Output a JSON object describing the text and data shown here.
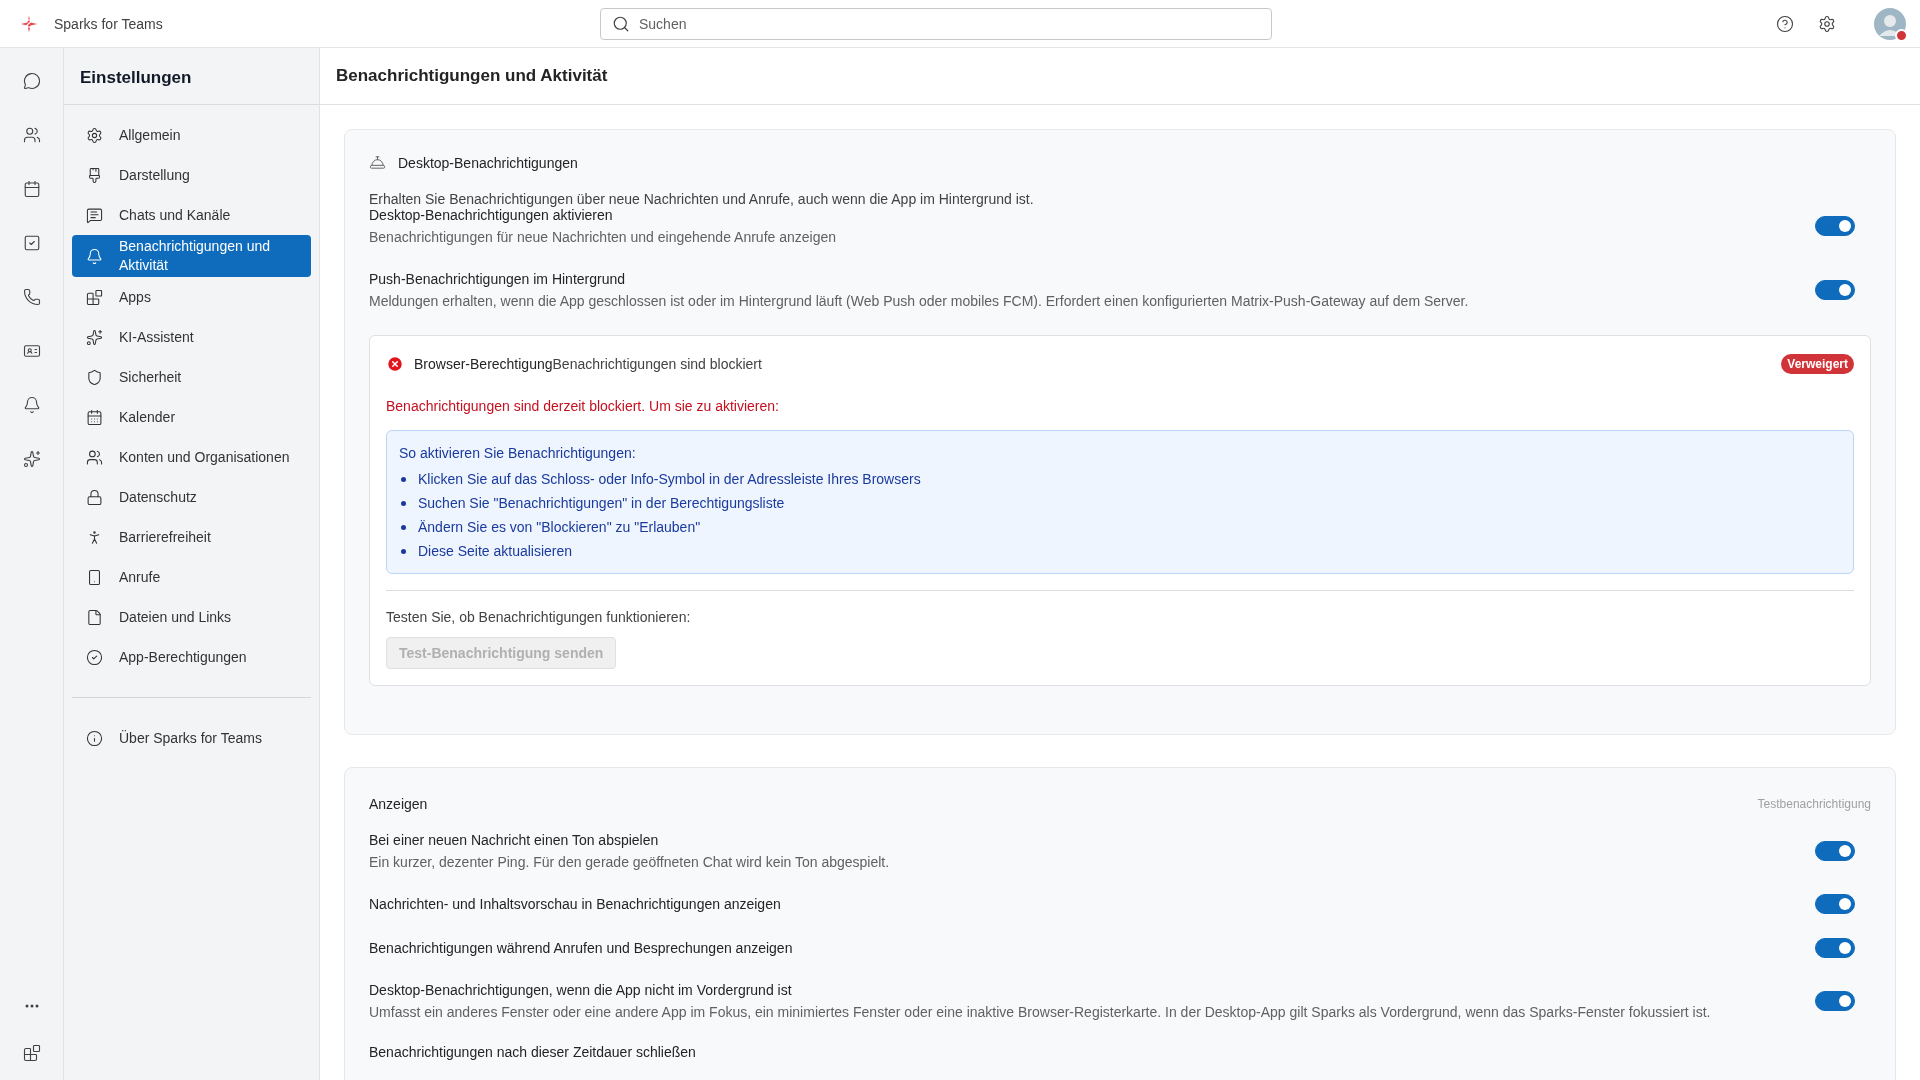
{
  "app": {
    "name": "Sparks for Teams"
  },
  "search": {
    "placeholder": "Suchen"
  },
  "settings_nav": {
    "title": "Einstellungen",
    "items": [
      {
        "label": "Allgemein",
        "selected": false
      },
      {
        "label": "Darstellung",
        "selected": false
      },
      {
        "label": "Chats und Kanäle",
        "selected": false
      },
      {
        "label": "Benachrichtigungen und Aktivität",
        "selected": true
      },
      {
        "label": "Apps",
        "selected": false
      },
      {
        "label": "KI-Assistent",
        "selected": false
      },
      {
        "label": "Sicherheit",
        "selected": false
      },
      {
        "label": "Kalender",
        "selected": false
      },
      {
        "label": "Konten und Organisationen",
        "selected": false
      },
      {
        "label": "Datenschutz",
        "selected": false
      },
      {
        "label": "Barrierefreiheit",
        "selected": false
      },
      {
        "label": "Anrufe",
        "selected": false
      },
      {
        "label": "Dateien und Links",
        "selected": false
      },
      {
        "label": "App-Berechtigungen",
        "selected": false
      }
    ],
    "footer_items": [
      {
        "label": "Über Sparks for Teams",
        "selected": false
      }
    ]
  },
  "page": {
    "title": "Benachrichtigungen und Aktivität"
  },
  "desktop_card": {
    "title": "Desktop-Benachrichtigungen",
    "intro": "Erhalten Sie Benachrichtigungen über neue Nachrichten und Anrufe, auch wenn die App im Hintergrund ist.",
    "settings": [
      {
        "label": "Desktop-Benachrichtigungen aktivieren",
        "description": "Benachrichtigungen für neue Nachrichten und eingehende Anrufe anzeigen",
        "on": true
      },
      {
        "label": "Push-Benachrichtigungen im Hintergrund",
        "description": "Meldungen erhalten, wenn die App geschlossen ist oder im Hintergrund läuft (Web Push oder mobiles FCM). Erfordert einen konfigurierten Matrix-Push-Gateway auf dem Server.",
        "on": true
      }
    ],
    "permission": {
      "label": "Browser-Berechtigung",
      "status": "Benachrichtigungen sind blockiert",
      "badge": "Verweigert",
      "warning": "Benachrichtigungen sind derzeit blockiert. Um sie zu aktivieren:",
      "help_title": "So aktivieren Sie Benachrichtigungen:",
      "steps": [
        "Klicken Sie auf das Schloss- oder Info-Symbol in der Adressleiste Ihres Browsers",
        "Suchen Sie \"Benachrichtigungen\" in der Berechtigungsliste",
        "Ändern Sie es von \"Blockieren\" zu \"Erlauben\"",
        "Diese Seite aktualisieren"
      ],
      "test_prompt": "Testen Sie, ob Benachrichtigungen funktionieren:",
      "test_button": {
        "label": "Test-Benachrichtigung senden",
        "disabled": true
      }
    }
  },
  "display_card": {
    "title": "Anzeigen",
    "action": "Testbenachrichtigung",
    "settings": [
      {
        "kind": "toggle",
        "label": "Bei einer neuen Nachricht einen Ton abspielen",
        "description": "Ein kurzer, dezenter Ping. Für den gerade geöffneten Chat wird kein Ton abgespielt.",
        "on": true
      },
      {
        "kind": "toggle",
        "label": "Nachrichten- und Inhaltsvorschau in Benachrichtigungen anzeigen",
        "on": true
      },
      {
        "kind": "toggle",
        "label": "Benachrichtigungen während Anrufen und Besprechungen anzeigen",
        "on": true
      },
      {
        "kind": "toggle",
        "label": "Desktop-Benachrichtigungen, wenn die App nicht im Vordergrund ist",
        "description": "Umfasst ein anderes Fenster oder eine andere App im Fokus, ein minimiertes Fenster oder eine inaktive Browser-Registerkarte. In der Desktop-App gilt Sparks als Vordergrund, wenn das Sparks-Fenster fokussiert ist.",
        "on": true
      },
      {
        "kind": "label",
        "label": "Benachrichtigungen nach dieser Zeitdauer schließen"
      }
    ]
  }
}
